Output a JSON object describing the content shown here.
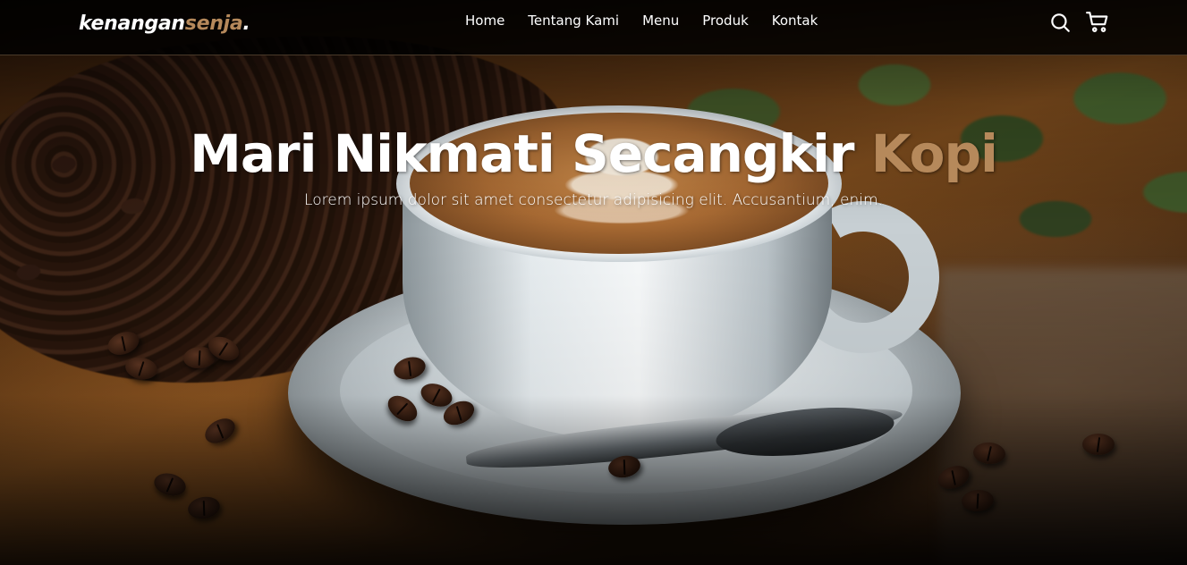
{
  "brand": {
    "logo_main": "kenangan",
    "logo_accent": "senja",
    "logo_dot": ".",
    "accent_color": "#b6895b"
  },
  "nav": {
    "items": [
      {
        "label": "Home"
      },
      {
        "label": "Tentang Kami"
      },
      {
        "label": "Menu"
      },
      {
        "label": "Produk"
      },
      {
        "label": "Kontak"
      }
    ],
    "icons": [
      "search-icon",
      "shopping-cart-icon"
    ]
  },
  "hero": {
    "title_main": "Mari Nikmati Secangkir ",
    "title_accent": "Kopi",
    "subtitle": "Lorem ipsum dolor sit amet consectetur adipisicing elit. Accusantium, enim."
  }
}
